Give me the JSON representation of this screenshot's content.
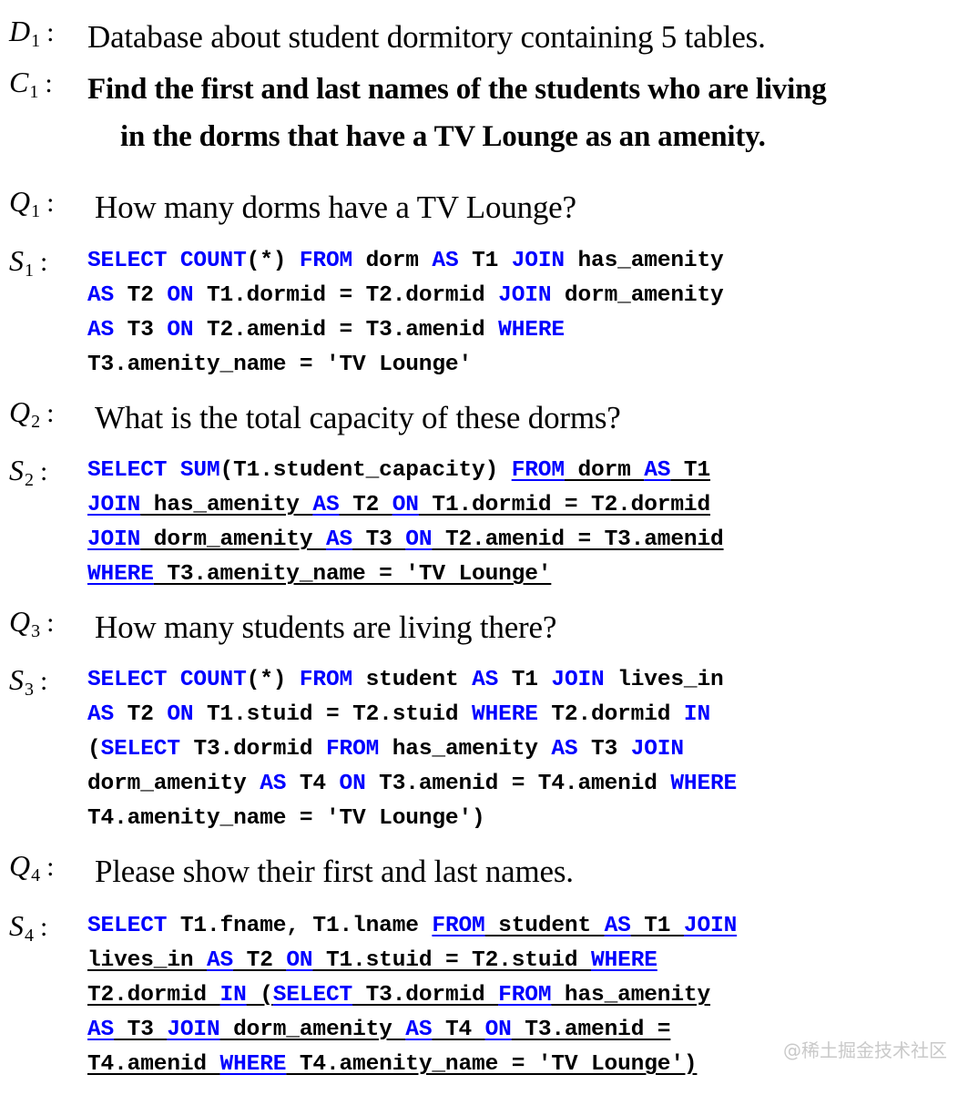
{
  "document": {
    "type": "text-to-sql conversational example figure",
    "watermark": "@稀土掘金技术社区",
    "accent_color": "#0000ff",
    "text_color": "#000000",
    "background_color": "#ffffff"
  },
  "labels": {
    "d1": {
      "symbol": "D",
      "subscript": "1",
      "colon": ":"
    },
    "c1": {
      "symbol": "C",
      "subscript": "1",
      "colon": ":"
    },
    "q1": {
      "symbol": "Q",
      "subscript": "1",
      "colon": ":"
    },
    "s1": {
      "symbol": "S",
      "subscript": "1",
      "colon": ":"
    },
    "q2": {
      "symbol": "Q",
      "subscript": "2",
      "colon": ":"
    },
    "s2": {
      "symbol": "S",
      "subscript": "2",
      "colon": ":"
    },
    "q3": {
      "symbol": "Q",
      "subscript": "3",
      "colon": ":"
    },
    "s3": {
      "symbol": "S",
      "subscript": "3",
      "colon": ":"
    },
    "q4": {
      "symbol": "Q",
      "subscript": "4",
      "colon": ":"
    },
    "s4": {
      "symbol": "S",
      "subscript": "4",
      "colon": ":"
    }
  },
  "database_description": {
    "line1": "Database about student dormitory containing 5 tables."
  },
  "complex_question": {
    "line1": "Find the first and last names of the students who are living",
    "line2": "in the dorms that have a TV Lounge as an amenity."
  },
  "turns": [
    {
      "question": "How many dorms have a TV Lounge?",
      "sql_lines": [
        [
          {
            "t": "SELECT COUNT",
            "kw": true,
            "ul": false
          },
          {
            "t": "(*) ",
            "kw": false,
            "ul": false
          },
          {
            "t": "FROM",
            "kw": true,
            "ul": false
          },
          {
            "t": " dorm ",
            "kw": false,
            "ul": false
          },
          {
            "t": "AS",
            "kw": true,
            "ul": false
          },
          {
            "t": " T1 ",
            "kw": false,
            "ul": false
          },
          {
            "t": "JOIN",
            "kw": true,
            "ul": false
          },
          {
            "t": " has_amenity",
            "kw": false,
            "ul": false
          }
        ],
        [
          {
            "t": "AS",
            "kw": true,
            "ul": false
          },
          {
            "t": " T2 ",
            "kw": false,
            "ul": false
          },
          {
            "t": "ON",
            "kw": true,
            "ul": false
          },
          {
            "t": " T1.dormid = T2.dormid ",
            "kw": false,
            "ul": false
          },
          {
            "t": "JOIN",
            "kw": true,
            "ul": false
          },
          {
            "t": " dorm_amenity",
            "kw": false,
            "ul": false
          }
        ],
        [
          {
            "t": "AS",
            "kw": true,
            "ul": false
          },
          {
            "t": " T3 ",
            "kw": false,
            "ul": false
          },
          {
            "t": "ON",
            "kw": true,
            "ul": false
          },
          {
            "t": " T2.amenid = T3.amenid ",
            "kw": false,
            "ul": false
          },
          {
            "t": "WHERE",
            "kw": true,
            "ul": false
          }
        ],
        [
          {
            "t": "T3.amenity_name = 'TV Lounge'",
            "kw": false,
            "ul": false
          }
        ]
      ]
    },
    {
      "question": "What is the total capacity of these dorms?",
      "sql_lines": [
        [
          {
            "t": "SELECT SUM",
            "kw": true,
            "ul": false
          },
          {
            "t": "(T1.student_capacity) ",
            "kw": false,
            "ul": false
          },
          {
            "t": "FROM",
            "kw": true,
            "ul": true
          },
          {
            "t": " dorm ",
            "kw": false,
            "ul": true
          },
          {
            "t": "AS",
            "kw": true,
            "ul": true
          },
          {
            "t": " T1",
            "kw": false,
            "ul": true
          }
        ],
        [
          {
            "t": "JOIN",
            "kw": true,
            "ul": true
          },
          {
            "t": " has_amenity ",
            "kw": false,
            "ul": true
          },
          {
            "t": "AS",
            "kw": true,
            "ul": true
          },
          {
            "t": " T2 ",
            "kw": false,
            "ul": true
          },
          {
            "t": "ON",
            "kw": true,
            "ul": true
          },
          {
            "t": " T1.dormid = T2.dormid",
            "kw": false,
            "ul": true
          }
        ],
        [
          {
            "t": "JOIN",
            "kw": true,
            "ul": true
          },
          {
            "t": " dorm_amenity ",
            "kw": false,
            "ul": true
          },
          {
            "t": "AS",
            "kw": true,
            "ul": true
          },
          {
            "t": " T3 ",
            "kw": false,
            "ul": true
          },
          {
            "t": "ON",
            "kw": true,
            "ul": true
          },
          {
            "t": " T2.amenid = T3.amenid",
            "kw": false,
            "ul": true
          }
        ],
        [
          {
            "t": "WHERE",
            "kw": true,
            "ul": true
          },
          {
            "t": " T3.amenity_name = 'TV Lounge'",
            "kw": false,
            "ul": true
          }
        ]
      ]
    },
    {
      "question": "How many students are living there?",
      "sql_lines": [
        [
          {
            "t": "SELECT COUNT",
            "kw": true,
            "ul": false
          },
          {
            "t": "(*) ",
            "kw": false,
            "ul": false
          },
          {
            "t": "FROM",
            "kw": true,
            "ul": false
          },
          {
            "t": " student ",
            "kw": false,
            "ul": false
          },
          {
            "t": "AS",
            "kw": true,
            "ul": false
          },
          {
            "t": " T1 ",
            "kw": false,
            "ul": false
          },
          {
            "t": "JOIN",
            "kw": true,
            "ul": false
          },
          {
            "t": " lives_in",
            "kw": false,
            "ul": false
          }
        ],
        [
          {
            "t": "AS",
            "kw": true,
            "ul": false
          },
          {
            "t": " T2 ",
            "kw": false,
            "ul": false
          },
          {
            "t": "ON",
            "kw": true,
            "ul": false
          },
          {
            "t": " T1.stuid = T2.stuid ",
            "kw": false,
            "ul": false
          },
          {
            "t": "WHERE",
            "kw": true,
            "ul": false
          },
          {
            "t": " T2.dormid ",
            "kw": false,
            "ul": false
          },
          {
            "t": "IN",
            "kw": true,
            "ul": false
          }
        ],
        [
          {
            "t": "(",
            "kw": false,
            "ul": false
          },
          {
            "t": "SELECT",
            "kw": true,
            "ul": false
          },
          {
            "t": " T3.dormid ",
            "kw": false,
            "ul": false
          },
          {
            "t": "FROM",
            "kw": true,
            "ul": false
          },
          {
            "t": " has_amenity ",
            "kw": false,
            "ul": false
          },
          {
            "t": "AS",
            "kw": true,
            "ul": false
          },
          {
            "t": " T3 ",
            "kw": false,
            "ul": false
          },
          {
            "t": "JOIN",
            "kw": true,
            "ul": false
          }
        ],
        [
          {
            "t": "dorm_amenity ",
            "kw": false,
            "ul": false
          },
          {
            "t": "AS",
            "kw": true,
            "ul": false
          },
          {
            "t": " T4 ",
            "kw": false,
            "ul": false
          },
          {
            "t": "ON",
            "kw": true,
            "ul": false
          },
          {
            "t": " T3.amenid = T4.amenid ",
            "kw": false,
            "ul": false
          },
          {
            "t": "WHERE",
            "kw": true,
            "ul": false
          }
        ],
        [
          {
            "t": "T4.amenity_name = 'TV Lounge')",
            "kw": false,
            "ul": false
          }
        ]
      ]
    },
    {
      "question": "Please show their first and last names.",
      "sql_lines": [
        [
          {
            "t": "SELECT",
            "kw": true,
            "ul": false
          },
          {
            "t": " T1.fname, T1.lname ",
            "kw": false,
            "ul": false
          },
          {
            "t": "FROM",
            "kw": true,
            "ul": true
          },
          {
            "t": " student ",
            "kw": false,
            "ul": true
          },
          {
            "t": "AS",
            "kw": true,
            "ul": true
          },
          {
            "t": " T1 ",
            "kw": false,
            "ul": true
          },
          {
            "t": "JOIN",
            "kw": true,
            "ul": true
          }
        ],
        [
          {
            "t": "lives_in ",
            "kw": false,
            "ul": true
          },
          {
            "t": "AS",
            "kw": true,
            "ul": true
          },
          {
            "t": " T2 ",
            "kw": false,
            "ul": true
          },
          {
            "t": "ON",
            "kw": true,
            "ul": true
          },
          {
            "t": " T1.stuid = T2.stuid ",
            "kw": false,
            "ul": true
          },
          {
            "t": "WHERE",
            "kw": true,
            "ul": true
          }
        ],
        [
          {
            "t": "T2.dormid ",
            "kw": false,
            "ul": true
          },
          {
            "t": "IN",
            "kw": true,
            "ul": true
          },
          {
            "t": " (",
            "kw": false,
            "ul": true
          },
          {
            "t": "SELECT",
            "kw": true,
            "ul": true
          },
          {
            "t": " T3.dormid ",
            "kw": false,
            "ul": true
          },
          {
            "t": "FROM",
            "kw": true,
            "ul": true
          },
          {
            "t": " has_amenity",
            "kw": false,
            "ul": true
          }
        ],
        [
          {
            "t": "AS",
            "kw": true,
            "ul": true
          },
          {
            "t": " T3 ",
            "kw": false,
            "ul": true
          },
          {
            "t": "JOIN",
            "kw": true,
            "ul": true
          },
          {
            "t": " dorm_amenity ",
            "kw": false,
            "ul": true
          },
          {
            "t": "AS",
            "kw": true,
            "ul": true
          },
          {
            "t": " T4 ",
            "kw": false,
            "ul": true
          },
          {
            "t": "ON",
            "kw": true,
            "ul": true
          },
          {
            "t": " T3.amenid =",
            "kw": false,
            "ul": true
          }
        ],
        [
          {
            "t": "T4.amenid ",
            "kw": false,
            "ul": true
          },
          {
            "t": "WHERE",
            "kw": true,
            "ul": true
          },
          {
            "t": " T4.amenity_name = 'TV Lounge')",
            "kw": false,
            "ul": true
          }
        ]
      ]
    }
  ]
}
